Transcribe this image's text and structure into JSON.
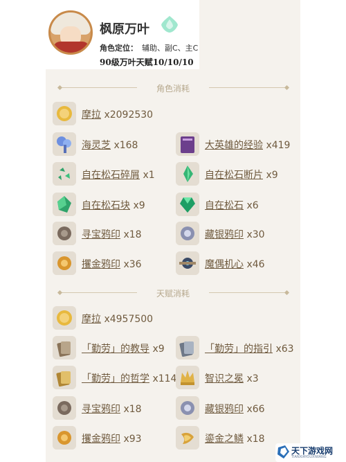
{
  "character": {
    "name": "枫原万叶",
    "role_label": "角色定位：",
    "role_value": "辅助、副C、主C",
    "level_talent": "90级万叶天赋10/10/10"
  },
  "sections": {
    "character": "角色消耗",
    "talent": "天赋消耗"
  },
  "character_items": [
    {
      "name": "摩拉",
      "qty": "x2092530",
      "icon": "mora-coin-icon"
    },
    {
      "name": "海灵芝",
      "qty": "x168",
      "icon": "sea-ganoderma-icon"
    },
    {
      "name": "大英雄的经验",
      "qty": "x419",
      "icon": "heros-wit-book-icon"
    },
    {
      "name": "自在松石碎屑",
      "qty": "x1",
      "icon": "turquoise-sliver-icon"
    },
    {
      "name": "自在松石断片",
      "qty": "x9",
      "icon": "turquoise-fragment-icon"
    },
    {
      "name": "自在松石块",
      "qty": "x9",
      "icon": "turquoise-chunk-icon"
    },
    {
      "name": "自在松石",
      "qty": "x6",
      "icon": "turquoise-gemstone-icon"
    },
    {
      "name": "寻宝鸦印",
      "qty": "x18",
      "icon": "treasure-hoarder-insignia-icon"
    },
    {
      "name": "藏银鸦印",
      "qty": "x30",
      "icon": "silver-raven-insignia-icon"
    },
    {
      "name": "攫金鸦印",
      "qty": "x36",
      "icon": "golden-raven-insignia-icon"
    },
    {
      "name": "魔偶机心",
      "qty": "x46",
      "icon": "marionette-core-icon"
    }
  ],
  "talent_items": [
    {
      "name": "摩拉",
      "qty": "x4957500",
      "icon": "mora-coin-icon"
    },
    {
      "name": "「勤劳」的教导",
      "qty": "x9",
      "icon": "teachings-of-diligence-icon"
    },
    {
      "name": "「勤劳」的指引",
      "qty": "x63",
      "icon": "guide-to-diligence-icon"
    },
    {
      "name": "「勤劳」的哲学",
      "qty": "x114",
      "icon": "philosophies-of-diligence-icon"
    },
    {
      "name": "智识之冕",
      "qty": "x3",
      "icon": "crown-of-insight-icon"
    },
    {
      "name": "寻宝鸦印",
      "qty": "x18",
      "icon": "treasure-hoarder-insignia-icon"
    },
    {
      "name": "藏银鸦印",
      "qty": "x66",
      "icon": "silver-raven-insignia-icon"
    },
    {
      "name": "攫金鸦印",
      "qty": "x93",
      "icon": "golden-raven-insignia-icon"
    },
    {
      "name": "鎏金之鳞",
      "qty": "x18",
      "icon": "gilded-scale-icon"
    }
  ],
  "watermark": {
    "text": "天下游戏网",
    "sub": "TIANXIAYOUXIWANG"
  },
  "colors": {
    "card_bg": "#f5f2ed",
    "label": "#6f5a3e",
    "section_title": "#b7a98e",
    "anemo": "#6fd6b0"
  }
}
